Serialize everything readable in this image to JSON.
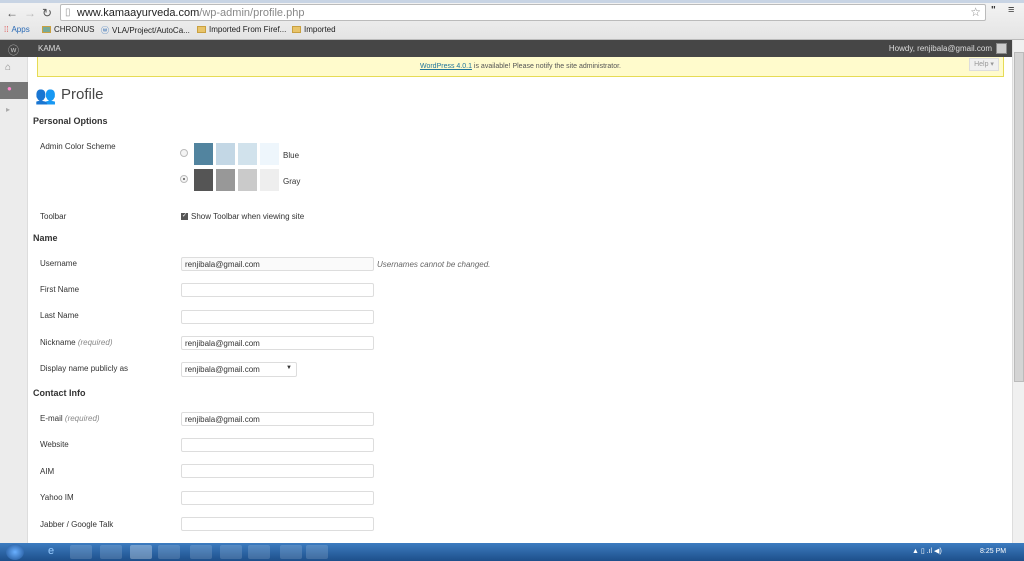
{
  "browser": {
    "url_host": "www.kamaayurveda.com",
    "url_path": "/wp-admin/profile.php",
    "bookmarks": [
      {
        "label": "Apps",
        "icon": "apps-grid-icon"
      },
      {
        "label": "CHRONUS",
        "icon": "image-icon"
      },
      {
        "label": "VLA/Project/AutoCa...",
        "icon": "wordpress-icon"
      },
      {
        "label": "Imported From Firef...",
        "icon": "folder-icon"
      },
      {
        "label": "Imported",
        "icon": "folder-icon"
      }
    ]
  },
  "adminbar": {
    "site": "KAMA",
    "greeting": "Howdy, renjibala@gmail.com"
  },
  "notice": {
    "link": "WordPress 4.0.1",
    "text": " is available! Please notify the site administrator.",
    "help": "Help ▾"
  },
  "page": {
    "title": "Profile"
  },
  "personal": {
    "heading": "Personal Options",
    "color_label": "Admin Color Scheme",
    "schemes": [
      {
        "name": "Blue",
        "selected": false,
        "colors": [
          "#52849f",
          "#c3d7e5",
          "#d1e2ec",
          "#eef6fc"
        ]
      },
      {
        "name": "Gray",
        "selected": true,
        "colors": [
          "#555555",
          "#989898",
          "#cacaca",
          "#eeeeee"
        ]
      }
    ],
    "toolbar_label": "Toolbar",
    "toolbar_option": "Show Toolbar when viewing site",
    "toolbar_checked": true
  },
  "name": {
    "heading": "Name",
    "username_label": "Username",
    "username": "renjibala@gmail.com",
    "username_note": "Usernames cannot be changed.",
    "first_label": "First Name",
    "first": "",
    "last_label": "Last Name",
    "last": "",
    "nick_label": "Nickname",
    "required": "(required)",
    "nick": "renjibala@gmail.com",
    "display_label": "Display name publicly as",
    "display": "renjibala@gmail.com"
  },
  "contact": {
    "heading": "Contact Info",
    "email_label": "E-mail",
    "required": "(required)",
    "email": "renjibala@gmail.com",
    "website_label": "Website",
    "website": "",
    "aim_label": "AIM",
    "aim": "",
    "yahoo_label": "Yahoo IM",
    "yahoo": "",
    "jabber_label": "Jabber / Google Talk",
    "jabber": ""
  },
  "taskbar": {
    "clock": "8:25 PM"
  }
}
